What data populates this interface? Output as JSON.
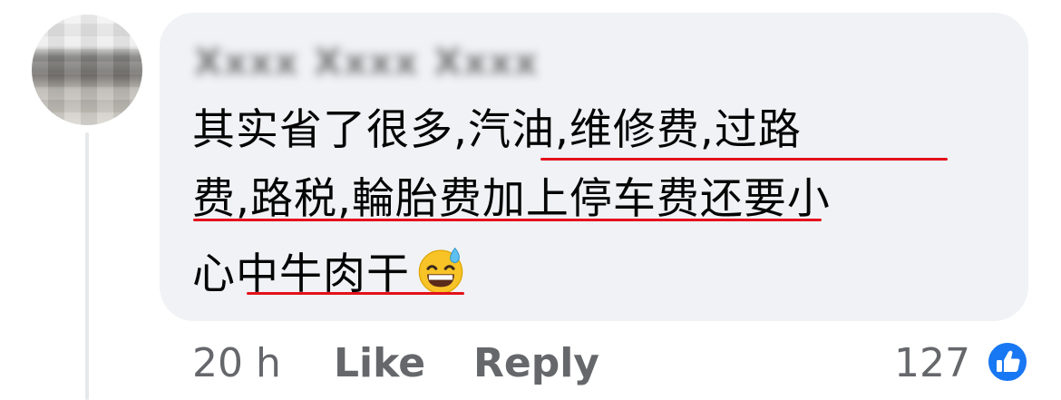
{
  "comment": {
    "author": "Xxxx Xxxx Xxxx",
    "lines": [
      "其实省了很多,汽油,维修费,过路",
      "费,路税,輪胎费加上停车费还要小",
      "心中牛肉干"
    ],
    "emoji": "grinning-face-with-sweat-icon"
  },
  "meta": {
    "time": "20 h",
    "like_label": "Like",
    "reply_label": "Reply",
    "reaction_count": "127"
  },
  "colors": {
    "bubble": "#f0f2f5",
    "underline": "#e4111c",
    "like_badge": "#1877f2"
  }
}
